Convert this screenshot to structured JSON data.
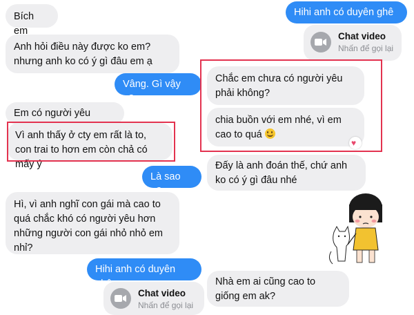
{
  "messages": [
    {
      "text": "Bích em"
    },
    {
      "text": "Hihi anh có duyên ghê"
    },
    {
      "text": "Anh hỏi điều này được ko em? nhưng anh ko có ý gì đâu em ạ"
    },
    {
      "text": "Vâng. Gì vậy ạ?"
    },
    {
      "text": "Chắc em chưa có người yêu phải không?"
    },
    {
      "text": "Em có người yêu chưa?"
    },
    {
      "text": "chia buồn với em nhé, vì em cao to quá"
    },
    {
      "text": "Vì anh thấy ở cty em rất là to, con trai to hơn em còn chả có mấy ý"
    },
    {
      "text": "Là sao ạ?"
    },
    {
      "text": "Đấy là anh đoán thế, chứ anh ko có ý gì đâu nhé"
    },
    {
      "text": "Hì, vì anh nghĩ con gái mà cao to quá chắc khó có người yêu hơn những người con gái nhỏ nhỏ em nhỉ?"
    },
    {
      "text": "Hihi anh có duyên ghê"
    },
    {
      "text": "Nhà em ai cũng cao to giống em ak?"
    }
  ],
  "video_call": {
    "title": "Chat video",
    "subtitle": "Nhấn để gọi lại"
  },
  "emoji": "grinning-face",
  "reaction": "heart",
  "colors": {
    "outgoing": "#2f8cf6",
    "incoming": "#eeeef0",
    "highlight": "#e3324f"
  }
}
